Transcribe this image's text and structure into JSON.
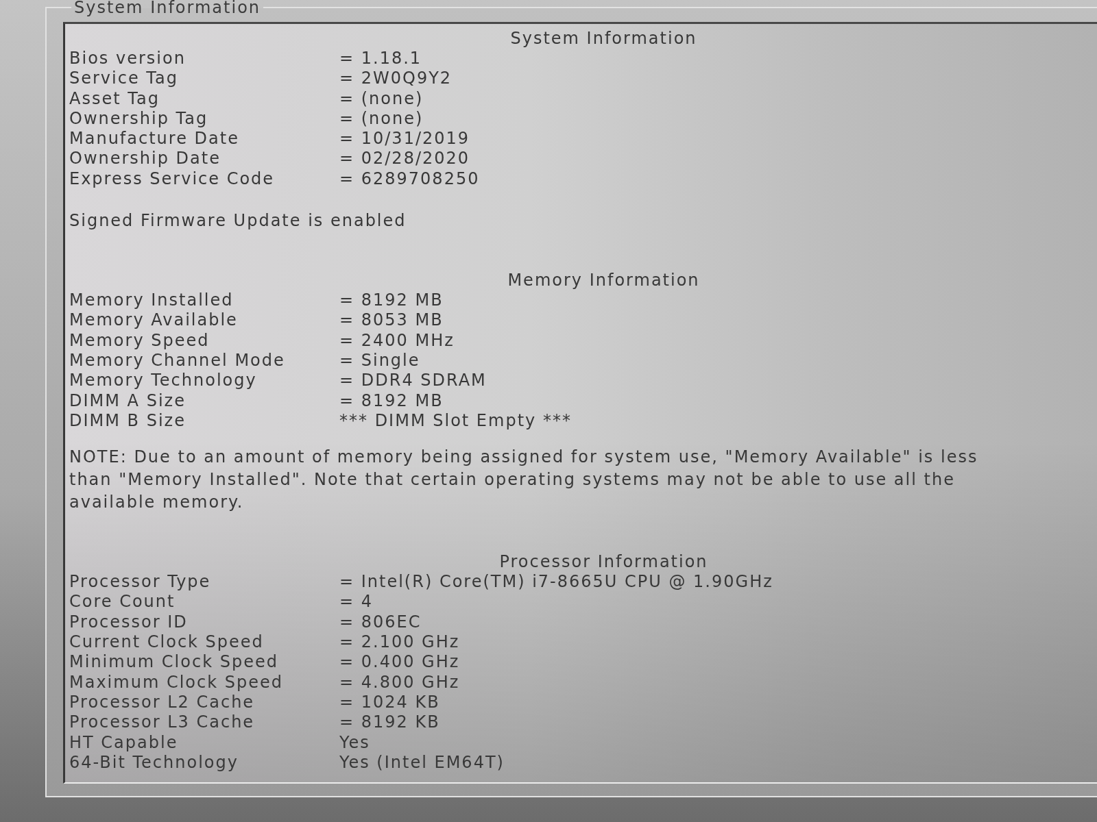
{
  "group_box": {
    "title": "System Information"
  },
  "sections": [
    {
      "title": "System Information",
      "rows": [
        {
          "label": "Bios version",
          "value": "= 1.18.1"
        },
        {
          "label": "Service Tag",
          "value": "= 2W0Q9Y2"
        },
        {
          "label": "Asset Tag",
          "value": "= (none)"
        },
        {
          "label": "Ownership Tag",
          "value": "= (none)"
        },
        {
          "label": "Manufacture Date",
          "value": "= 10/31/2019"
        },
        {
          "label": "Ownership Date",
          "value": "= 02/28/2020"
        },
        {
          "label": "Express Service Code",
          "value": "= 6289708250"
        }
      ],
      "note": "Signed Firmware Update is enabled"
    },
    {
      "title": "Memory Information",
      "rows": [
        {
          "label": "Memory Installed",
          "value": "= 8192 MB"
        },
        {
          "label": "Memory Available",
          "value": "= 8053 MB"
        },
        {
          "label": "Memory Speed",
          "value": "= 2400 MHz"
        },
        {
          "label": "Memory Channel Mode",
          "value": "= Single"
        },
        {
          "label": "Memory Technology",
          "value": "= DDR4 SDRAM"
        },
        {
          "label": "DIMM A Size",
          "value": "= 8192 MB"
        },
        {
          "label": "DIMM B Size",
          "value": "*** DIMM Slot Empty ***"
        }
      ],
      "note": "NOTE: Due to an amount of memory being assigned for system use, \"Memory Available\" is less than \"Memory Installed\". Note that certain operating systems may not be able to use all the available memory."
    },
    {
      "title": "Processor Information",
      "rows": [
        {
          "label": "Processor Type",
          "value": "= Intel(R) Core(TM) i7-8665U CPU @ 1.90GHz"
        },
        {
          "label": "Core Count",
          "value": "= 4"
        },
        {
          "label": "Processor ID",
          "value": "= 806EC"
        },
        {
          "label": "Current Clock Speed",
          "value": "= 2.100 GHz"
        },
        {
          "label": "Minimum Clock Speed",
          "value": "= 0.400 GHz"
        },
        {
          "label": "Maximum Clock Speed",
          "value": "= 4.800 GHz"
        },
        {
          "label": "Processor L2 Cache",
          "value": "= 1024 KB"
        },
        {
          "label": "Processor L3 Cache",
          "value": "= 8192 KB"
        },
        {
          "label": "HT Capable",
          "value": "Yes"
        },
        {
          "label": "64-Bit Technology",
          "value": "Yes (Intel EM64T)"
        }
      ]
    }
  ]
}
